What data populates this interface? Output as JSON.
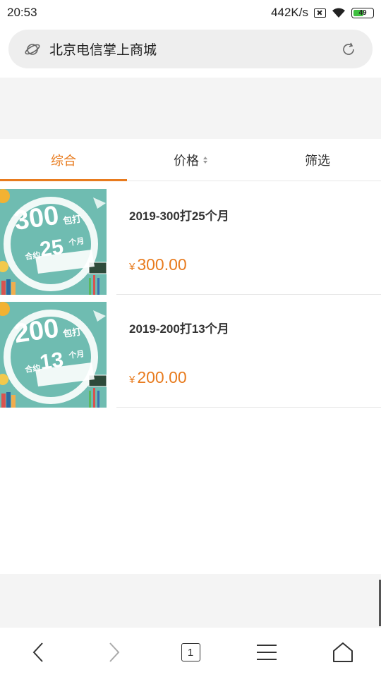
{
  "status_bar": {
    "time": "20:53",
    "network_speed": "442K/s",
    "battery_level": "49",
    "icons": [
      "no-sim-icon",
      "wifi-icon",
      "battery-icon"
    ]
  },
  "address_bar": {
    "title": "北京电信掌上商城",
    "left_icon": "planet-icon",
    "right_icon": "refresh-icon"
  },
  "tabs": [
    {
      "label": "综合",
      "active": true
    },
    {
      "label": "价格",
      "active": false
    },
    {
      "label": "筛选",
      "active": false
    }
  ],
  "products": [
    {
      "name": "2019-300打25个月",
      "currency": "¥",
      "price": "300.00",
      "thumb": {
        "big": "300",
        "suffix": "包打",
        "prefix": "合约",
        "months": "25",
        "unit": "个月"
      }
    },
    {
      "name": "2019-200打13个月",
      "currency": "¥",
      "price": "200.00",
      "thumb": {
        "big": "200",
        "suffix": "包打",
        "prefix": "合约",
        "months": "13",
        "unit": "个月"
      }
    }
  ],
  "bottom_nav": {
    "tab_count": "1",
    "icons": [
      "back-icon",
      "forward-icon",
      "tabs-icon",
      "menu-icon",
      "home-icon"
    ]
  },
  "colors": {
    "accent": "#e87b1e",
    "thumb_bg": "#6fbcb1"
  }
}
